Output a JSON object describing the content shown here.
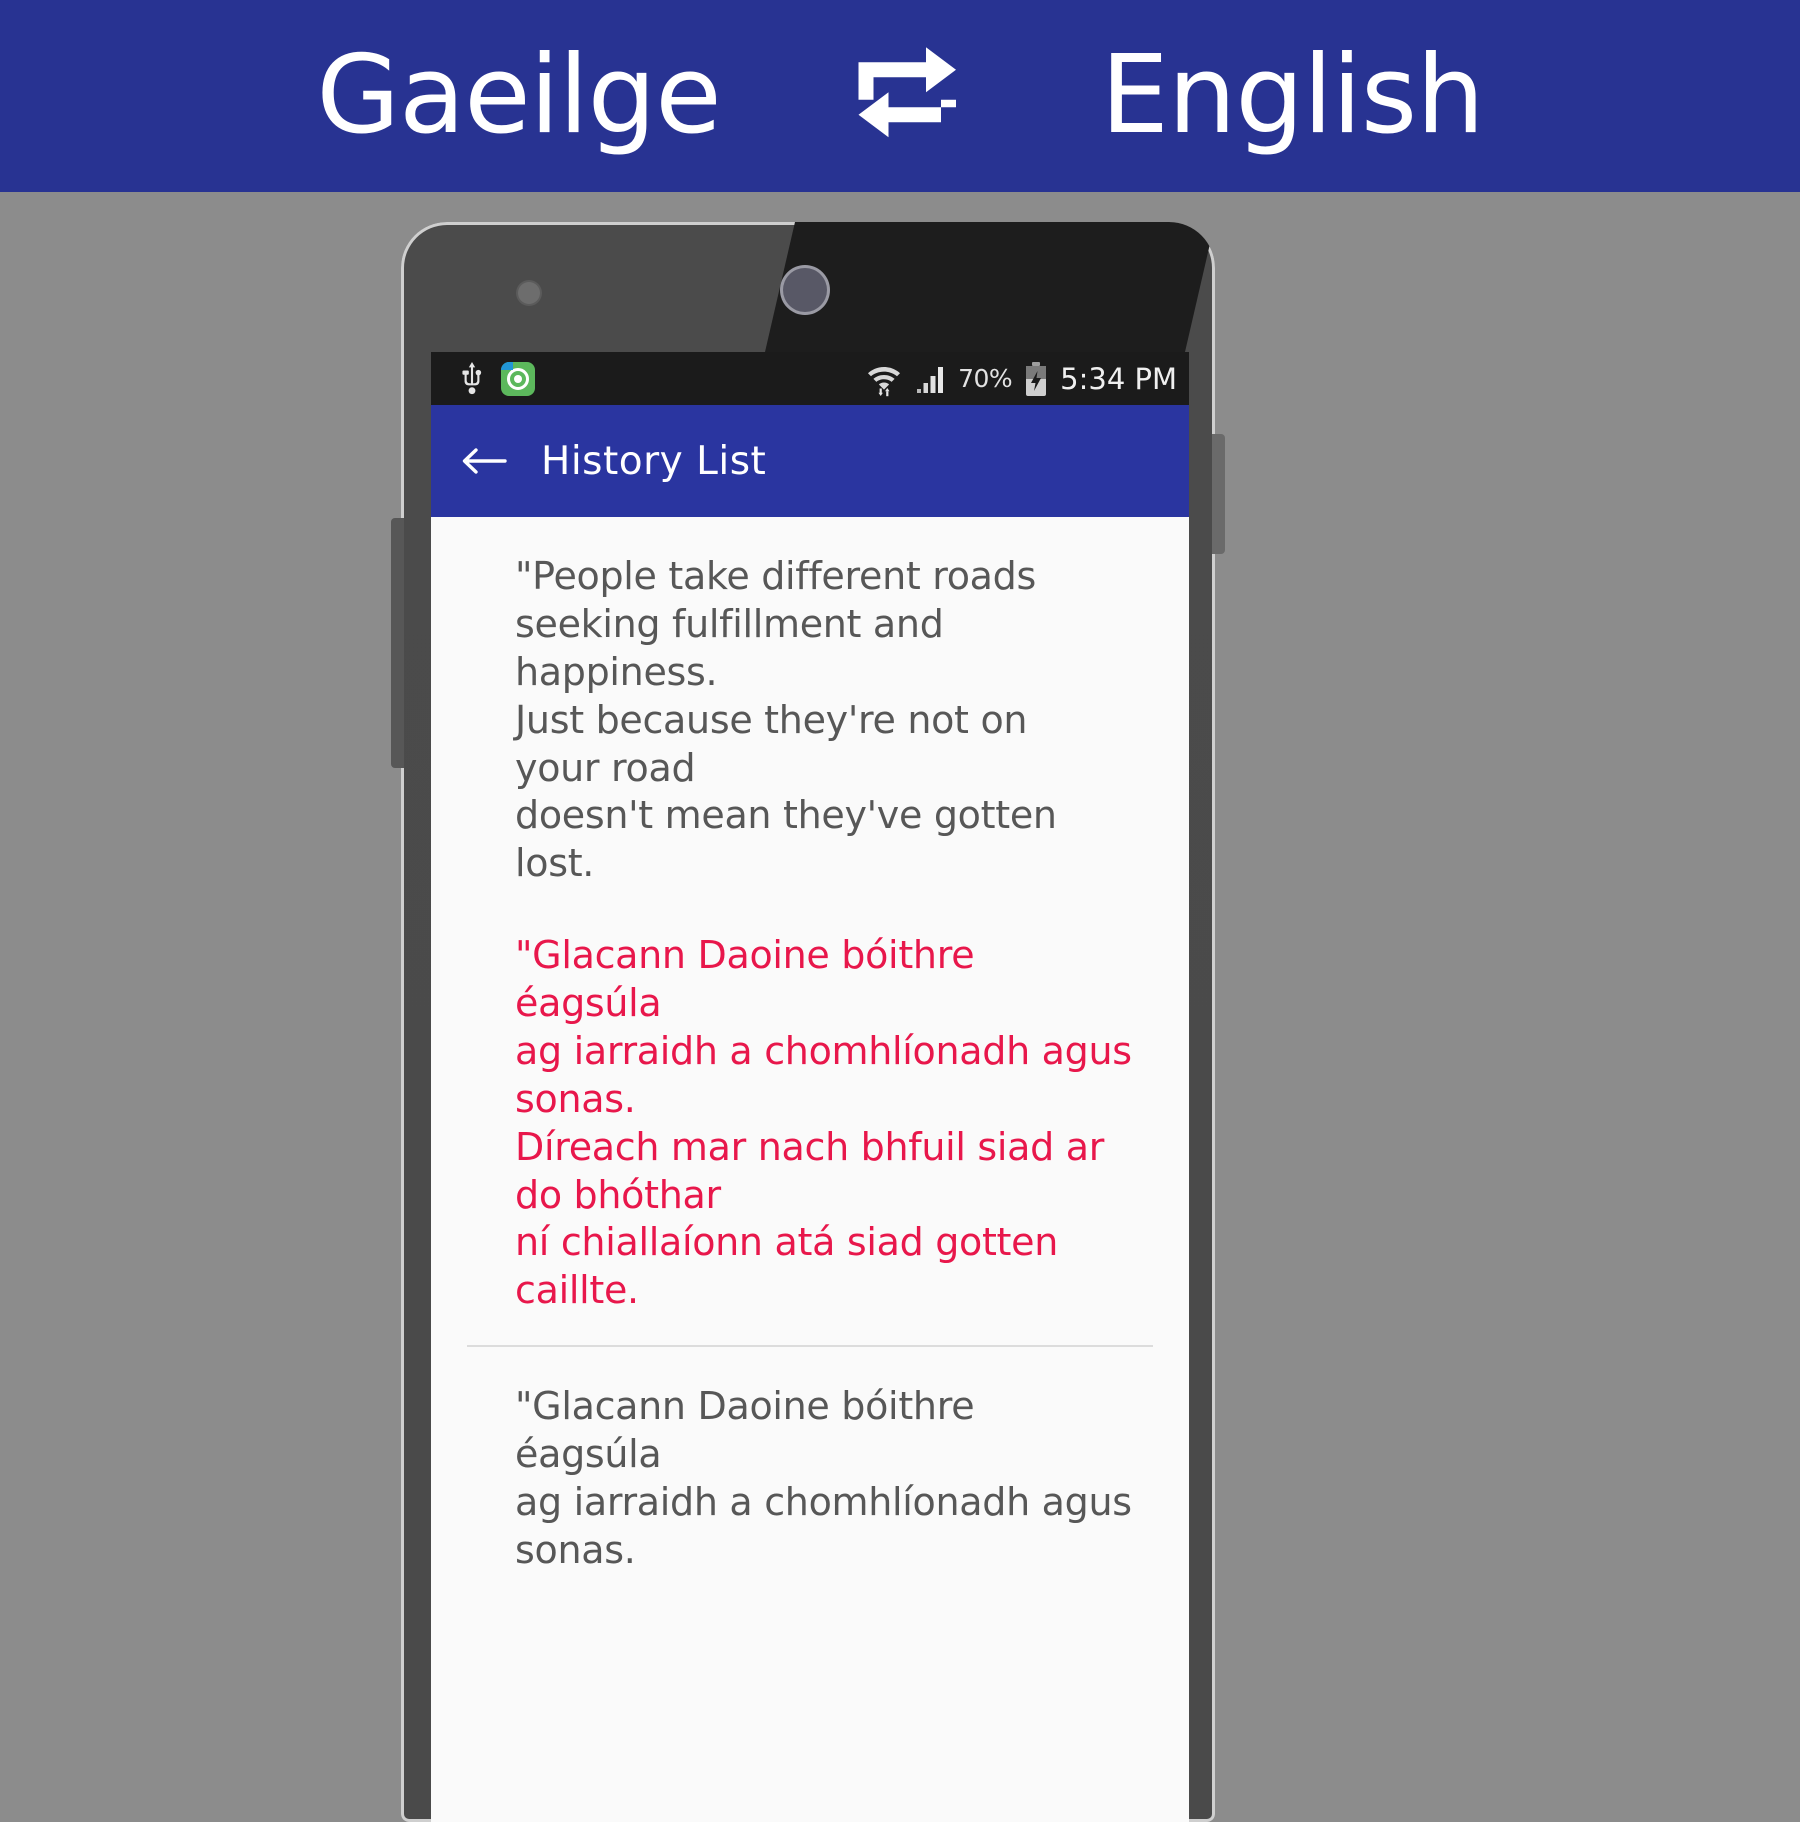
{
  "promo_banner": {
    "source_language": "Gaeilge",
    "swap_icon": "repeat-swap-icon",
    "target_language": "English",
    "background_color": "#283392",
    "text_color": "#FFFFFF"
  },
  "device": {
    "frame_color": "#4B4B4B",
    "bezel_color": "#CFCFCF"
  },
  "status_bar": {
    "background_color": "#1B1B1B",
    "icons_left": [
      "usb-icon",
      "app-notification-icon"
    ],
    "icons_right": [
      "wifi-icon",
      "signal-icon",
      "battery-charging-icon"
    ],
    "battery_percent": "70%",
    "clock": "5:34 PM"
  },
  "app_bar": {
    "back_icon": "back-arrow-icon",
    "title": "History List",
    "background_color": "#2A35A0",
    "text_color": "#FFFFFF"
  },
  "history_list": {
    "items": [
      {
        "english": "\"People take different roads\nseeking fulfillment and\nhappiness.\nJust because they're not on\nyour road\ndoesn't mean they've gotten\nlost.",
        "irish": "\"Glacann Daoine bóithre\néagsúla\nag iarraidh a chomhlíonadh agus\nsonas.\nDíreach mar nach bhfuil siad ar\ndo bhóthar\nní chiallaíonn atá siad gotten\ncaillte.",
        "english_color": "#575757",
        "irish_color": "#E8174B"
      },
      {
        "english": "\"Glacann Daoine bóithre\néagsúla\nag iarraidh a chomhlíonadh agus\nsonas.",
        "irish": "",
        "english_color": "#575757",
        "irish_color": "#E8174B"
      }
    ]
  }
}
